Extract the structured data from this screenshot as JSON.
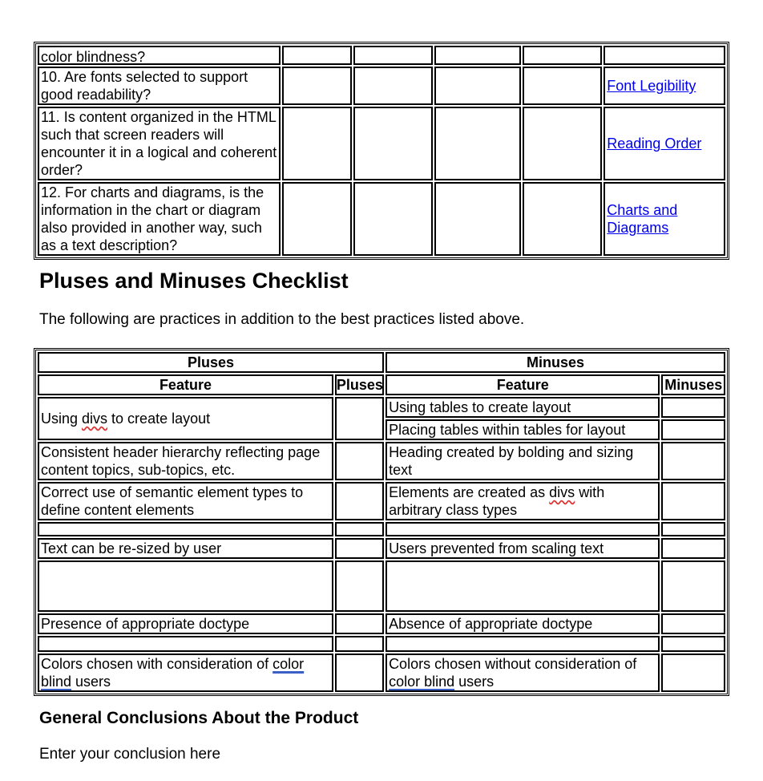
{
  "top_table": {
    "rows": [
      {
        "question": "color blindness?",
        "link": ""
      },
      {
        "question": "10. Are fonts selected to support good readability?",
        "link": "Font Legibility"
      },
      {
        "question": "11. Is content organized in the HTML such that screen readers will encounter it in a logical and coherent order?",
        "link": "Reading Order"
      },
      {
        "question": "12. For charts and diagrams, is the information in the chart or diagram also provided in another way, such as a text description?",
        "link": "Charts and Diagrams"
      }
    ]
  },
  "pm_section": {
    "heading": "Pluses and Minuses Checklist",
    "intro": "The following are practices in addition to the best practices listed above."
  },
  "pm_table": {
    "pluses_header": "Pluses",
    "minuses_header": "Minuses",
    "plus_feature_col": "Feature",
    "plus_score_col": "Pluses",
    "minus_feature_col": "Feature",
    "minus_score_col": "Minuses",
    "pluses": [
      {
        "pre": "Using ",
        "flag": "divs",
        "post": " to create layout"
      },
      {
        "text": "Consistent header hierarchy reflecting page content topics, sub-topics, etc."
      },
      {
        "text": "Correct use of semantic element types to define content elements"
      },
      {
        "text": ""
      },
      {
        "text": "Text can be re-sized by user"
      },
      {
        "text": ""
      },
      {
        "text": "Presence of appropriate doctype"
      },
      {
        "text": ""
      },
      {
        "pre": "Colors chosen with consideration of ",
        "flag": "color blind",
        "post": " users"
      }
    ],
    "minuses": [
      {
        "text": "Using tables to create layout"
      },
      {
        "text": "Placing tables within tables for layout"
      },
      {
        "text": "Heading created by bolding and sizing text"
      },
      {
        "pre": "Elements are created as ",
        "flag": "divs",
        "post": " with arbitrary class types"
      },
      {
        "text": ""
      },
      {
        "text": "Users prevented from scaling text"
      },
      {
        "text": ""
      },
      {
        "text": "Absence of appropriate doctype"
      },
      {
        "text": ""
      },
      {
        "pre": "Colors chosen without consideration of ",
        "flag": "color blind",
        "post": " users"
      }
    ]
  },
  "conclusion": {
    "heading": "General Conclusions About the Product",
    "placeholder": "Enter your conclusion here"
  },
  "colors": {
    "link": "#0000ee",
    "spell_flag": "#d33333",
    "grammar_flag": "#3b5fc4"
  }
}
